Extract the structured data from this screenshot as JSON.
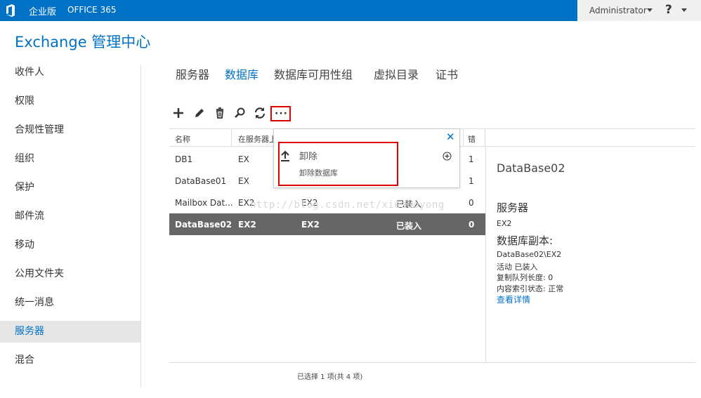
{
  "topbar": {
    "edition": "企业版",
    "office365": "OFFICE 365",
    "user": "Administrator",
    "help": "?",
    "logo_icon": "office-logo-icon",
    "brand_color": "#0072c6"
  },
  "app": {
    "title": "Exchange 管理中心"
  },
  "nav": {
    "items": [
      {
        "label": "收件人"
      },
      {
        "label": "权限"
      },
      {
        "label": "合规性管理"
      },
      {
        "label": "组织"
      },
      {
        "label": "保护"
      },
      {
        "label": "邮件流"
      },
      {
        "label": "移动"
      },
      {
        "label": "公用文件夹"
      },
      {
        "label": "统一消息"
      },
      {
        "label": "服务器",
        "active": true
      },
      {
        "label": "混合"
      }
    ]
  },
  "tabs": [
    {
      "label": "服务器"
    },
    {
      "label": "数据库",
      "active": true
    },
    {
      "label": "数据库可用性组"
    },
    {
      "label": "虚拟目录"
    },
    {
      "label": "证书"
    }
  ],
  "toolbar": {
    "icons": [
      "add-icon",
      "edit-icon",
      "delete-icon",
      "search-icon",
      "refresh-icon"
    ],
    "more": "···"
  },
  "table": {
    "headers": [
      "名称",
      "在服务器上",
      "错..."
    ],
    "header_visible": [
      "名称",
      "在服务器上",
      "错"
    ],
    "rows": [
      {
        "name": "DB1",
        "server": "EX",
        "col3": "",
        "status": "",
        "count": "1"
      },
      {
        "name": "DataBase01",
        "server": "EX",
        "col3": "",
        "status": "",
        "count": "1"
      },
      {
        "name": "Mailbox Dat...",
        "server": "EX2",
        "col3": "EX2",
        "status": "已装入",
        "count": "0"
      },
      {
        "name": "DataBase02",
        "server": "EX2",
        "col3": "EX2",
        "status": "已装入",
        "count": "0",
        "selected": true
      }
    ]
  },
  "watermark": "http://blog.csdn.net/xiezuoyong",
  "dropdown": {
    "title": "卸除",
    "subtitle": "卸除数据库",
    "close": "✕"
  },
  "detail": {
    "title": "DataBase02",
    "server_heading": "服务器",
    "server_value": "EX2",
    "copies_heading": "数据库副本:",
    "copy_name": "DataBase02\\EX2",
    "copy_status": "活动 已装入",
    "queue_length": "复制队列长度: 0",
    "index_state": "内容索引状态: 正常",
    "link": "查看详情"
  },
  "footer": {
    "status": "已选择 1 项(共 4 项)"
  }
}
